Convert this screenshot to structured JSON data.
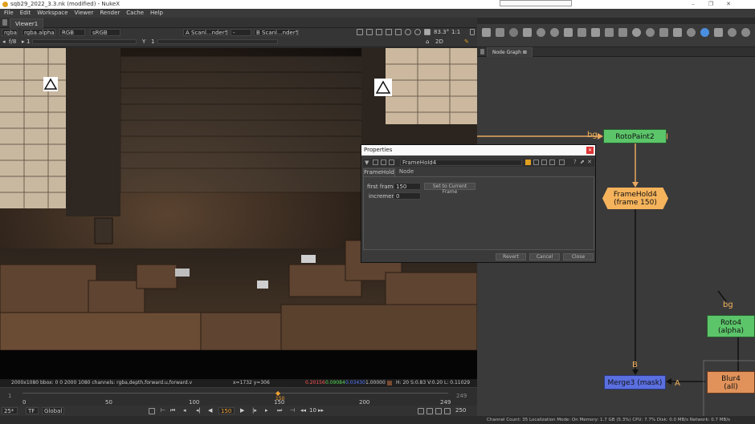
{
  "window": {
    "title": "sqb29_2022_3.3.nk (modified) - NukeX",
    "minimize": "–",
    "maximize": "❐",
    "close": "✕"
  },
  "menu": [
    "File",
    "Edit",
    "Workspace",
    "Viewer",
    "Render",
    "Cache",
    "Help"
  ],
  "viewer": {
    "tab": "Viewer1",
    "channels": "rgba",
    "alpha": "rgba.alpha",
    "colorspace": "RGB",
    "lut": "sRGB",
    "input_a": "A  Scanl...nder5",
    "input_a_op": "-",
    "input_b": "B  Scanl...nder5",
    "zoom": "83.3°",
    "ratio": "1:1",
    "mode": "2D",
    "frame_gain": "f/8",
    "gain_value": "1",
    "gamma_label": "Y",
    "gamma_value": "1"
  },
  "info": {
    "format": "2000x1080  bbox: 0 0 2000 1080  channels: rgba,depth,forward.u,forward.v",
    "coords": "x=1732 y=306",
    "r": "0.20156",
    "g": "0.09084",
    "b": "0.03430",
    "a": "1.00000",
    "hsv": "H: 20 S:0.83 V:0.20  L: 0.11029",
    "colors": {
      "r": "#ff5555",
      "g": "#55dd55",
      "b": "#5577ff"
    }
  },
  "timeline": {
    "ticks": [
      "0",
      "50",
      "100",
      "150",
      "200",
      "249"
    ],
    "start": "0",
    "end": "249",
    "current": "150",
    "start_field": "1",
    "end_field": "249"
  },
  "playbar": {
    "fps": "25*",
    "tf": "TF",
    "scope": "Global",
    "current_frame": "150",
    "increment": "10",
    "end_frame": "250"
  },
  "status": "Channel Count: 35  Localization Mode: On  Memory: 1.7 GB (5.3%)  CPU: 7.7%  Disk: 0.0 MB/s  Network: 0.7 MB/s",
  "nodegraph": {
    "tab": "Node Graph",
    "nodes": {
      "rotopaint": "RotoPaint2",
      "framehold_name": "FrameHold4",
      "framehold_sub": "(frame 150)",
      "roto_name": "Roto4",
      "roto_sub": "(alpha)",
      "merge": "Merge3 (mask)",
      "blur_name": "Blur4",
      "blur_sub": "(all)"
    },
    "labels": {
      "bg1": "bg",
      "bg2": "bg",
      "b": "B",
      "a": "A"
    },
    "colors": {
      "rotopaint": "#5cc56a",
      "framehold": "#f5b35c",
      "roto": "#5cc56a",
      "merge": "#5a6fe0",
      "blur": "#e0925a",
      "pipe": "#e8a860"
    }
  },
  "properties": {
    "title": "Properties",
    "node_name": "FrameHold4",
    "tabs": [
      "FrameHold",
      "Node"
    ],
    "first_frame_label": "first frame",
    "first_frame_value": "150",
    "set_current": "Set to Current Frame",
    "increment_label": "increment",
    "increment_value": "0",
    "revert": "Revert",
    "cancel": "Cancel",
    "close": "Close"
  }
}
